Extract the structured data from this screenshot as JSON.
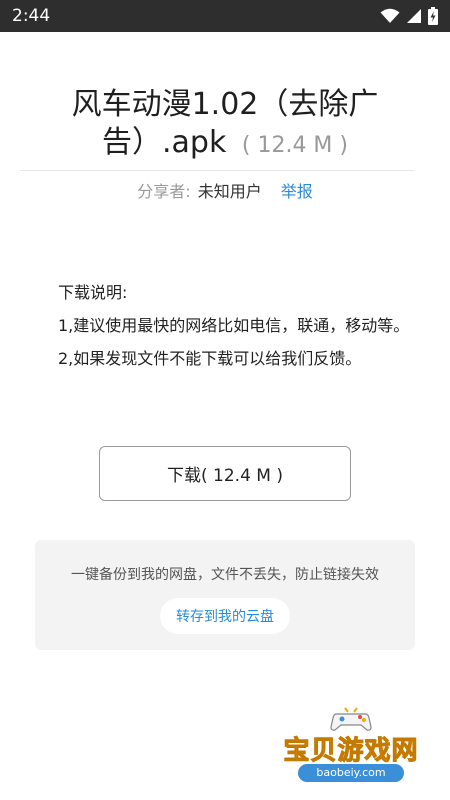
{
  "status_bar": {
    "time": "2:44"
  },
  "file": {
    "title": "风车动漫1.02（去除广告）.apk",
    "size": "( 12.4 M )"
  },
  "sharer": {
    "label": "分享者:",
    "name": "未知用户",
    "report_label": "举报"
  },
  "instructions": {
    "heading": "下载说明:",
    "line1": "1,建议使用最快的网络比如电信，联通，移动等。",
    "line2": "2,如果发现文件不能下载可以给我们反馈。"
  },
  "download_button": {
    "label": "下载( 12.4 M )"
  },
  "backup": {
    "text": "一键备份到我的网盘，文件不丢失，防止链接失效",
    "save_label": "转存到我的云盘"
  },
  "watermark": {
    "text": "宝贝游戏网",
    "url": "baobeiy.com"
  },
  "colors": {
    "link": "#2a8cd8",
    "status_bar": "#2e2e2e",
    "card_bg": "#f3f3f3"
  }
}
